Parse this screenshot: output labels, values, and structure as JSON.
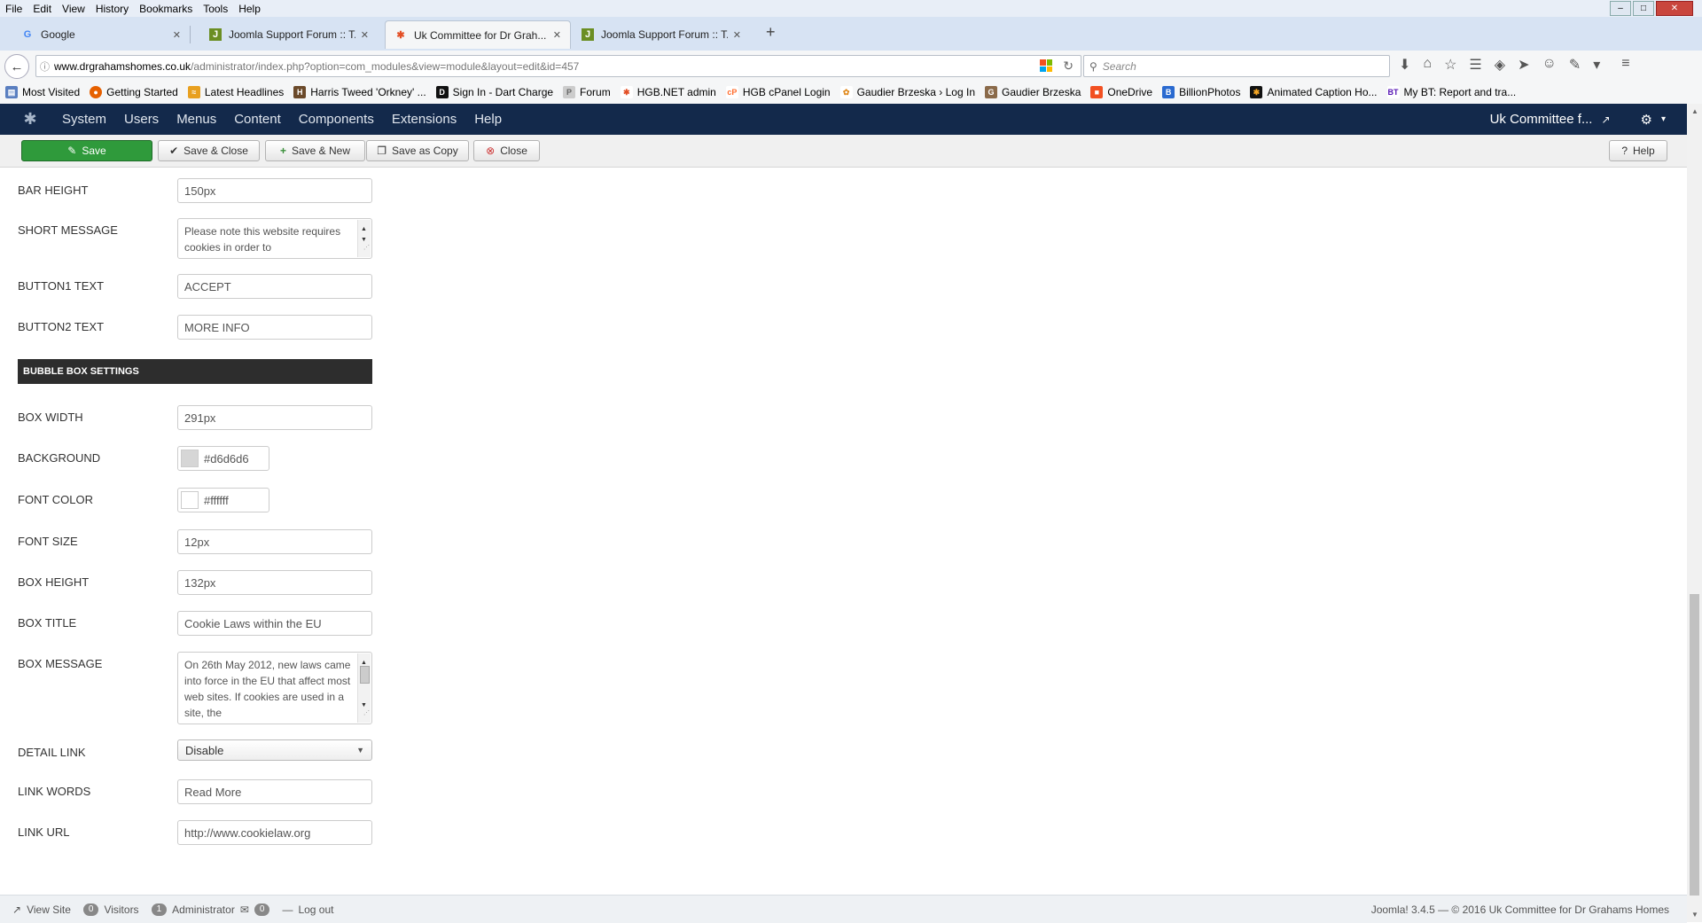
{
  "browser": {
    "menu": [
      "File",
      "Edit",
      "View",
      "History",
      "Bookmarks",
      "Tools",
      "Help"
    ],
    "tabs": [
      {
        "title": "Google",
        "icon": "google-icon"
      },
      {
        "title": "Joomla Support Forum :: T...",
        "icon": "forum-icon"
      },
      {
        "title": "Uk Committee for Dr Grah...",
        "icon": "joomla-icon"
      },
      {
        "title": "Joomla Support Forum :: T...",
        "icon": "forum-icon"
      }
    ],
    "url_domain": "www.drgrahamshomes.co.uk",
    "url_path": "/administrator/index.php?option=com_modules&view=module&layout=edit&id=457",
    "search_placeholder": "Search",
    "bookmarks": [
      "Most Visited",
      "Getting Started",
      "Latest Headlines",
      "Harris Tweed 'Orkney' ...",
      "Sign In - Dart Charge",
      "Forum",
      "HGB.NET admin",
      "HGB cPanel Login",
      "Gaudier Brzeska › Log In",
      "Gaudier Brzeska",
      "OneDrive",
      "BillionPhotos",
      "Animated Caption Ho...",
      "My BT: Report and tra..."
    ]
  },
  "joomla": {
    "nav": [
      "System",
      "Users",
      "Menus",
      "Content",
      "Components",
      "Extensions",
      "Help"
    ],
    "site_name": "Uk Committee f...",
    "toolbar": {
      "save": "Save",
      "save_close": "Save & Close",
      "save_new": "Save & New",
      "save_copy": "Save as Copy",
      "close": "Close",
      "help": "Help"
    },
    "fields": {
      "bar_height": {
        "label": "BAR HEIGHT",
        "value": "150px"
      },
      "short_message": {
        "label": "SHORT MESSAGE",
        "value": "Please note this website requires cookies in order to"
      },
      "button1_text": {
        "label": "BUTTON1 TEXT",
        "value": "ACCEPT"
      },
      "button2_text": {
        "label": "BUTTON2 TEXT",
        "value": "MORE INFO"
      },
      "section_title": "BUBBLE BOX SETTINGS",
      "box_width": {
        "label": "BOX WIDTH",
        "value": "291px"
      },
      "background": {
        "label": "BACKGROUND",
        "value": "#d6d6d6"
      },
      "font_color": {
        "label": "FONT COLOR",
        "value": "#ffffff"
      },
      "font_size": {
        "label": "FONT SIZE",
        "value": "12px"
      },
      "box_height": {
        "label": "BOX HEIGHT",
        "value": "132px"
      },
      "box_title": {
        "label": "BOX TITLE",
        "value": "Cookie Laws within the EU"
      },
      "box_message": {
        "label": "BOX MESSAGE",
        "value": "On 26th May 2012, new laws came into force in the EU that affect most web sites. If cookies are used in a site, the"
      },
      "detail_link": {
        "label": "DETAIL LINK",
        "value": "Disable"
      },
      "link_words": {
        "label": "LINK WORDS",
        "value": "Read More"
      },
      "link_url": {
        "label": "LINK URL",
        "value": "http://www.cookielaw.org"
      }
    },
    "footer": {
      "view_site": "View Site",
      "visitors_count": "0",
      "visitors": "Visitors",
      "admin_count": "1",
      "administrator": "Administrator",
      "messages_count": "0",
      "logout": "Log out",
      "copyright": "Joomla! 3.4.5 — © 2016 Uk Committee for Dr Grahams Homes"
    }
  },
  "colors": {
    "joomla_nav": "#13294b",
    "save_green": "#2f9a3b",
    "section_dark": "#2d2d2d",
    "background_swatch": "#d6d6d6",
    "font_color_swatch": "#ffffff"
  }
}
